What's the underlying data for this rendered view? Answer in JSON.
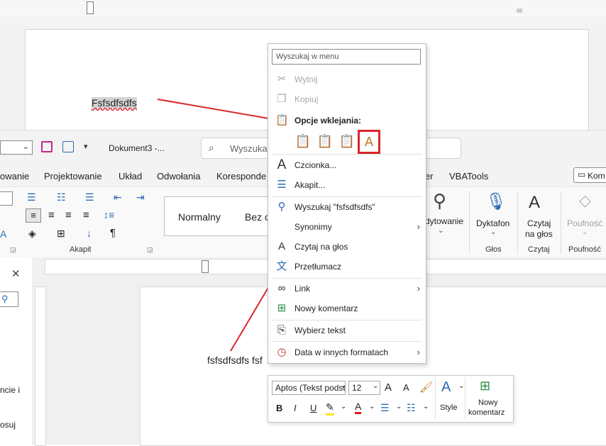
{
  "background_document": {
    "selected_word": "Fsfsdfsdfs"
  },
  "titlebar": {
    "doc_name": "Dokument3  -...",
    "search_placeholder": "Wyszukaj"
  },
  "tabs": [
    "owanie",
    "Projektowanie",
    "Układ",
    "Odwołania",
    "Koresponde",
    "er",
    "VBATools"
  ],
  "comments_button": "Kom",
  "ribbon": {
    "style_normal": "Normalny",
    "style_next": "Bez o",
    "group_paragraph": "Akapit",
    "dictate_partial": "dytowanie",
    "dictate_label": "Dyktafon",
    "read_aloud_line1": "Czytaj",
    "read_aloud_line2": "na głos",
    "sensitivity": "Poufność",
    "group_voice": "Głos",
    "group_read": "Czytaj",
    "group_sensitivity": "Poufność"
  },
  "side_pane": {
    "close": "✕",
    "text1": "ncie i",
    "text2": "osuj"
  },
  "document": {
    "body_text": "fsfsdfsdfs fsf"
  },
  "context_menu": {
    "search_placeholder": "Wyszukaj w menu",
    "items": {
      "cut": "Wytnij",
      "copy": "Kopiuj",
      "paste_options": "Opcje wklejania:",
      "font": "Czcionka...",
      "paragraph": "Akapit...",
      "search": "Wyszukaj \"fsfsdfsdfs\"",
      "synonyms": "Synonimy",
      "read_aloud": "Czytaj na głos",
      "translate": "Przetłumacz",
      "link": "Link",
      "new_comment": "Nowy komentarz",
      "select_text": "Wybierz tekst",
      "date_formats": "Data w innych formatach"
    }
  },
  "mini_toolbar": {
    "font": "Aptos (Tekst podst",
    "size": "12",
    "bold": "B",
    "italic": "I",
    "underline": "U",
    "style_label": "Style",
    "new_comment_line1": "Nowy",
    "new_comment_line2": "komentarz"
  },
  "colors": {
    "annotation_red": "#d9262b",
    "highlight_yellow": "#f2e829",
    "font_red": "#e0151b",
    "save_purple": "#c3258c"
  }
}
